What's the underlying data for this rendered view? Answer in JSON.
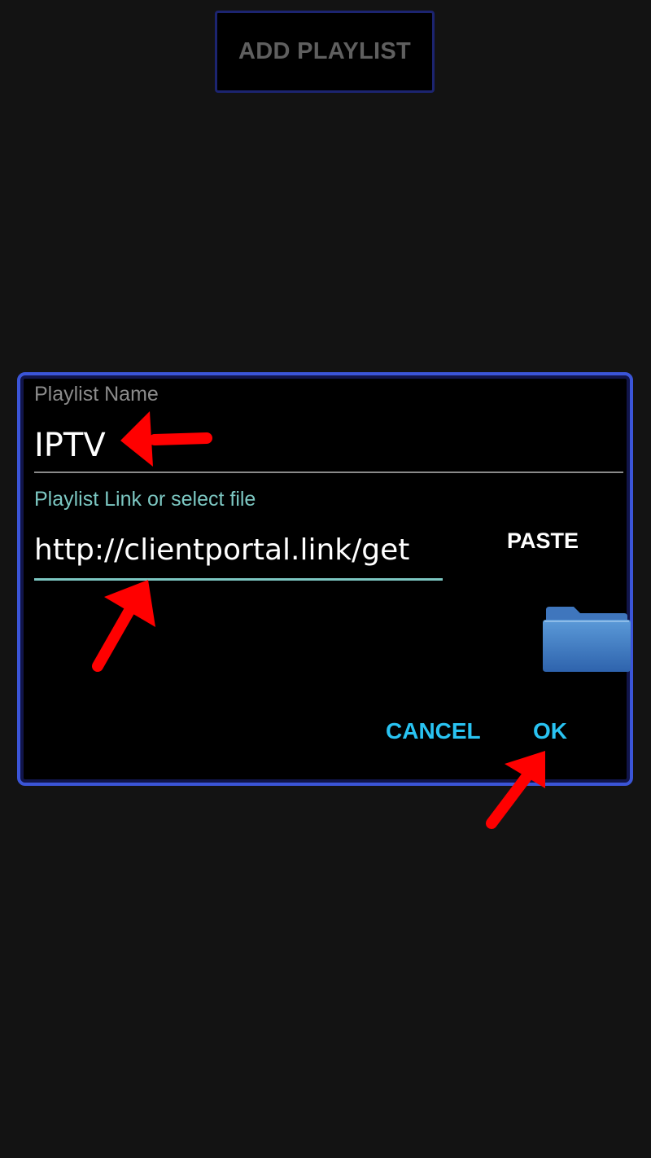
{
  "top_button": {
    "label": "ADD PLAYLIST"
  },
  "dialog": {
    "name_label": "Playlist Name",
    "name_value": "IPTV",
    "link_label": "Playlist Link or select file",
    "link_value": "http://clientportal.link/get",
    "paste_label": "PASTE",
    "folder_icon": "folder-icon",
    "cancel_label": "CANCEL",
    "ok_label": "OK"
  },
  "colors": {
    "background": "#131313",
    "dialog_border": "#3b55d8",
    "accent_teal": "#7cc7c2",
    "button_cyan": "#29c3f2",
    "annotation_red": "#ff0000"
  }
}
